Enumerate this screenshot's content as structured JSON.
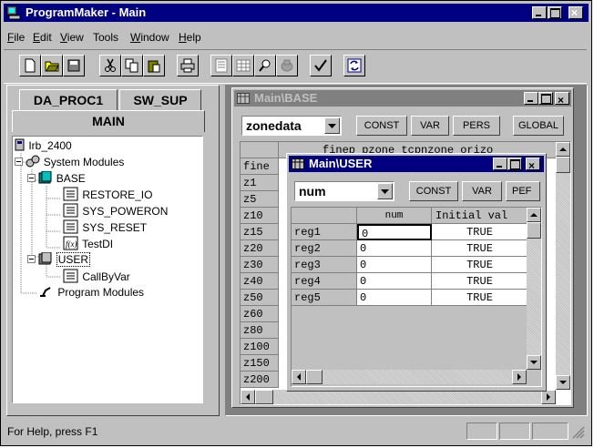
{
  "app": {
    "title": "ProgramMaker - Main"
  },
  "menu": [
    {
      "pre": "",
      "u": "F",
      "post": "ile"
    },
    {
      "pre": "",
      "u": "E",
      "post": "dit"
    },
    {
      "pre": "",
      "u": "V",
      "post": "iew"
    },
    {
      "pre": "Tools",
      "u": "",
      "post": ""
    },
    {
      "pre": "",
      "u": "W",
      "post": "indow"
    },
    {
      "pre": "",
      "u": "H",
      "post": "elp"
    }
  ],
  "tabs": {
    "left": "DA_PROC1",
    "right": "SW_SUP",
    "active": "MAIN"
  },
  "tree": {
    "root": "Irb_2400",
    "system_modules": "System Modules",
    "base": "BASE",
    "base_items": [
      "RESTORE_IO",
      "SYS_POWERON",
      "SYS_RESET",
      "TestDI"
    ],
    "user": "USER",
    "user_items": [
      "CallByVar"
    ],
    "program_modules": "Program Modules"
  },
  "base_window": {
    "title": "Main\\BASE",
    "combo_value": "zonedata",
    "buttons": [
      "CONST",
      "VAR",
      "PERS",
      "GLOBAL"
    ],
    "header_partial": "finep  pzone_tcpnzone_orizo",
    "row_names": [
      "fine",
      "z1",
      "z5",
      "z10",
      "z15",
      "z20",
      "z30",
      "z40",
      "z50",
      "z60",
      "z80",
      "z100",
      "z150",
      "z200"
    ]
  },
  "user_window": {
    "title": "Main\\USER",
    "combo_value": "num",
    "buttons": [
      "CONST",
      "VAR",
      "PEF"
    ],
    "columns": [
      "num",
      "Initial val"
    ],
    "rows": [
      {
        "name": "reg1",
        "value": "0",
        "initial": "TRUE"
      },
      {
        "name": "reg2",
        "value": "0",
        "initial": "TRUE"
      },
      {
        "name": "reg3",
        "value": "0",
        "initial": "TRUE"
      },
      {
        "name": "reg4",
        "value": "0",
        "initial": "TRUE"
      },
      {
        "name": "reg5",
        "value": "0",
        "initial": "TRUE"
      }
    ]
  },
  "status": {
    "text": "For Help, press F1"
  }
}
